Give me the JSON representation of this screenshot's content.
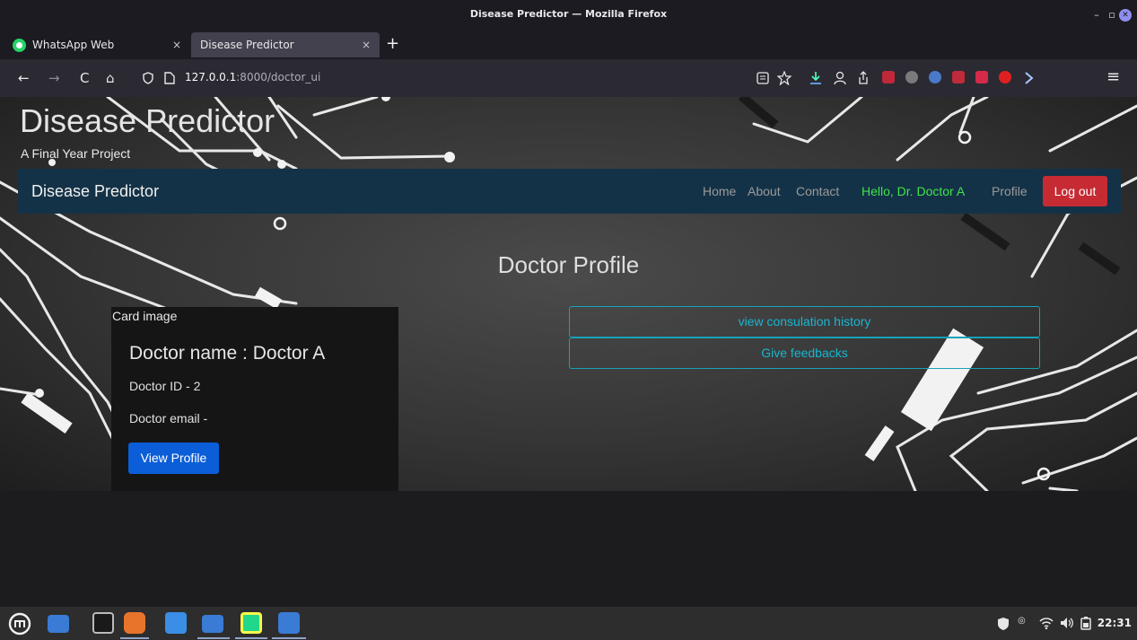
{
  "window": {
    "title": "Disease Predictor — Mozilla Firefox",
    "minimize_glyph": "–",
    "restore_glyph": "▫",
    "close_glyph": "✕"
  },
  "tabs": [
    {
      "label": "WhatsApp Web",
      "icon": "whatsapp-icon",
      "active": false
    },
    {
      "label": "Disease Predictor",
      "icon": "",
      "active": true
    }
  ],
  "tab_close_glyph": "×",
  "new_tab_glyph": "+",
  "toolbar": {
    "back": "←",
    "forward": "→",
    "reload": "C",
    "home": "⌂",
    "url_host": "127.0.0.1",
    "url_path": ":8000/doctor_ui",
    "menu": "≡"
  },
  "site": {
    "title": "Disease Predictor",
    "subtitle": "A Final Year Project"
  },
  "site_nav": {
    "brand": "Disease Predictor",
    "links": [
      "Home",
      "About",
      "Contact"
    ],
    "greeting": "Hello, Dr. Doctor A",
    "profile": "Profile",
    "logout": "Log out",
    "colors": {
      "bar": "#143247",
      "greeting": "#3ee44a",
      "logout": "#c62b34"
    }
  },
  "main": {
    "heading": "Doctor Profile",
    "card": {
      "image_alt": "Card image",
      "title": "Doctor name : Doctor A",
      "id_line": "Doctor ID - 2",
      "email_line": "Doctor email -",
      "button": "View Profile"
    },
    "actions": [
      "view consulation history",
      "Give feedbacks"
    ],
    "colors": {
      "primary": "#0b5ed7",
      "info": "#17a2b8"
    }
  },
  "taskbar": {
    "apps": [
      "mint-menu-icon",
      "show-desktop-icon",
      "terminal-icon",
      "firefox-icon",
      "vscode-icon",
      "files-icon",
      "pycharm-icon",
      "text-editor-icon"
    ],
    "clock": "22:31"
  }
}
